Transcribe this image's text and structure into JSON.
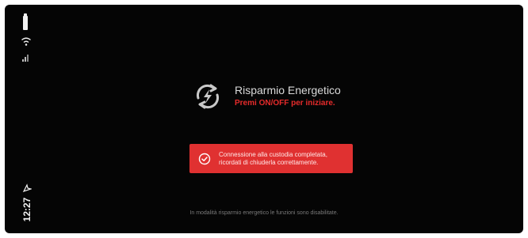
{
  "status": {
    "time": "12:27",
    "icons": [
      "battery-icon",
      "wifi-icon",
      "cellular-signal-icon",
      "location-arrow-icon"
    ]
  },
  "header": {
    "icon": "eco-refresh-lightning-icon",
    "title": "Risparmio Energetico",
    "subtitle": "Premi ON/OFF per iniziare."
  },
  "notification": {
    "icon": "check-circle-icon",
    "line1": "Connessione alla custodia completata,",
    "line2": "ricordati di chiuderla correttamente."
  },
  "footer": {
    "text": "In modalità risparmio energetico le funzioni sono disabilitate."
  },
  "colors": {
    "background": "#050505",
    "accent_red": "#e62b2b",
    "notice_bg": "#e03131",
    "title": "#d9d9d9",
    "footer": "#7a7a7a"
  }
}
